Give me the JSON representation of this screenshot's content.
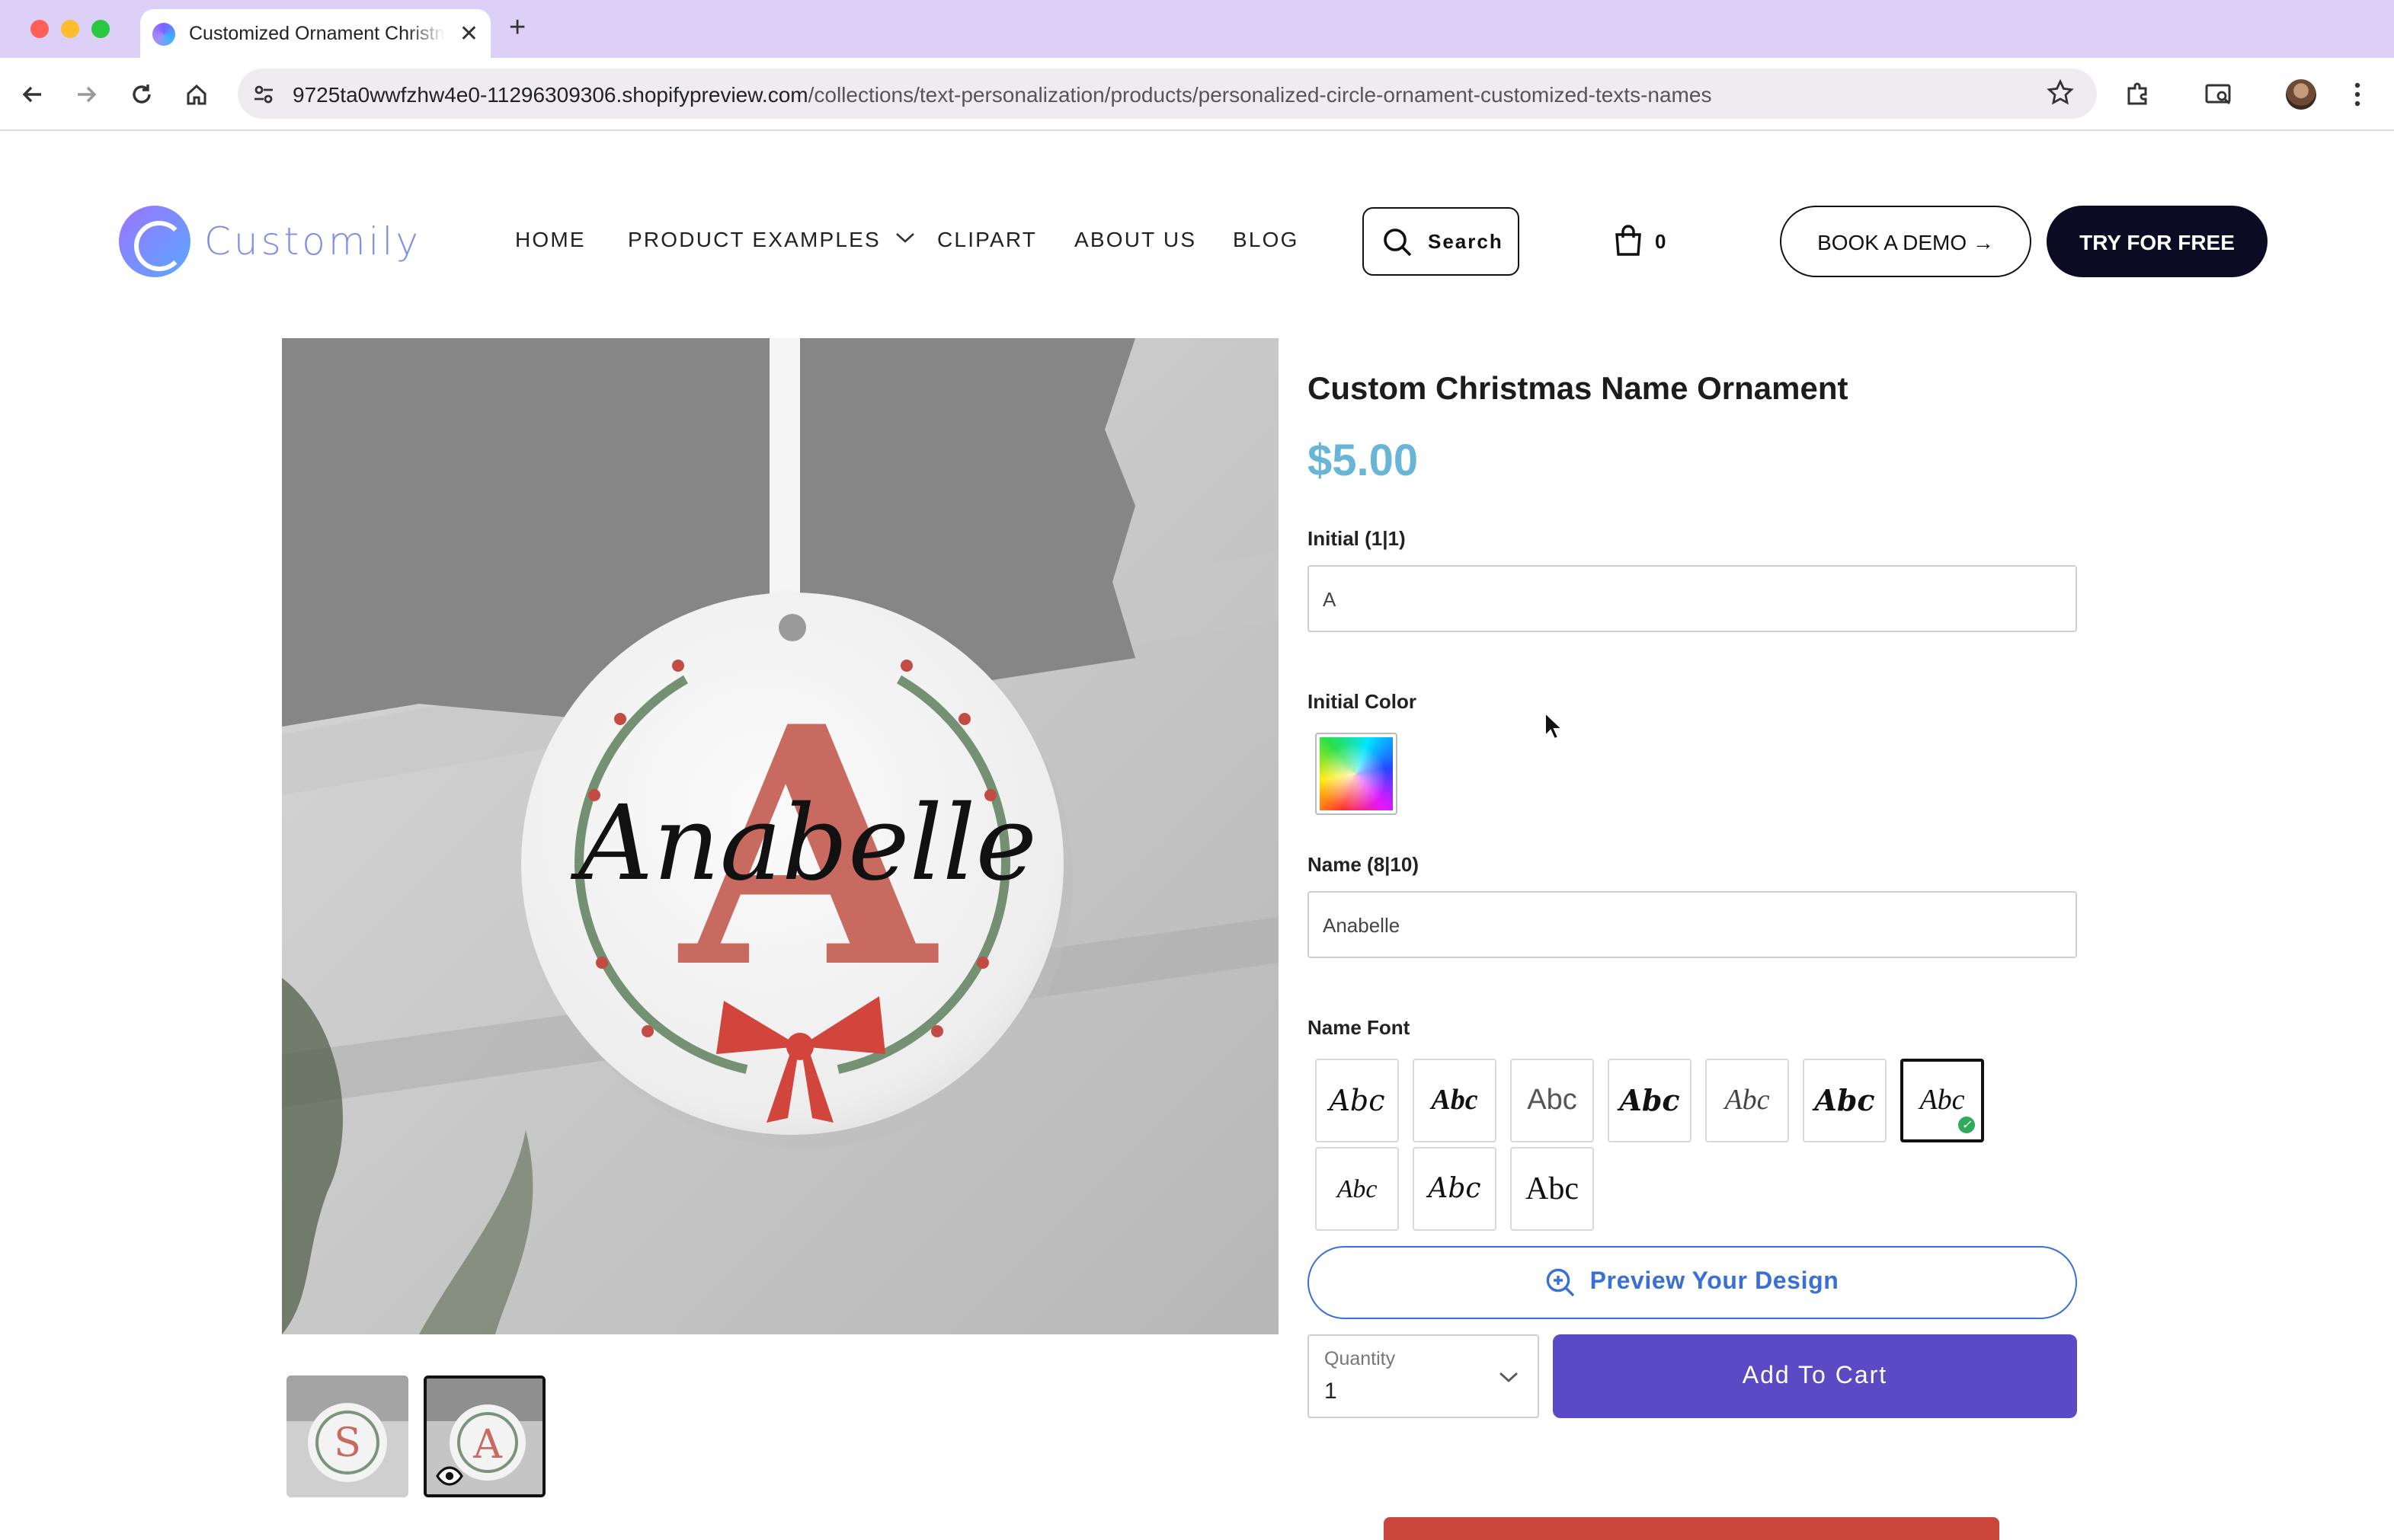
{
  "browser": {
    "tab_title": "Customized Ornament Christmas",
    "url_host": "9725ta0wwfzhw4e0-11296309306.shopifypreview.com",
    "url_path": "/collections/text-personalization/products/personalized-circle-ornament-customized-texts-names"
  },
  "header": {
    "logo_text": "Customily",
    "nav": [
      "HOME",
      "PRODUCT EXAMPLES",
      "CLIPART",
      "ABOUT US",
      "BLOG"
    ],
    "search_label": "Search",
    "cart_count": "0",
    "demo_label": "BOOK A DEMO →",
    "try_label": "TRY FOR FREE"
  },
  "gallery": {
    "main_initial": "A",
    "main_name": "Anabelle",
    "thumb1_initial": "S",
    "thumb2_initial": "A"
  },
  "product": {
    "title": "Custom Christmas Name Ornament",
    "price": "$5.00",
    "initial_label": "Initial (1|1)",
    "initial_value": "A",
    "color_label": "Initial Color",
    "name_label": "Name (8|10)",
    "name_value": "Anabelle",
    "font_label": "Name Font",
    "font_options": [
      "Abc",
      "Abc",
      "Abc",
      "Abc",
      "Abc",
      "Abc",
      "Abc",
      "Abc",
      "Abc",
      "Abc"
    ],
    "selected_font_index": 6,
    "preview_label": "Preview Your Design",
    "quantity_label": "Quantity",
    "quantity_value": "1",
    "add_to_cart_label": "Add To Cart"
  },
  "colors": {
    "tabbar": "#dcd0f7",
    "price": "#69b5d6",
    "preview_accent": "#3a6fd8",
    "add_to_cart": "#5a4ac3",
    "try_button": "#0d0a23",
    "initial_letter": "#c86a5f"
  },
  "icons": [
    "back-icon",
    "forward-icon",
    "reload-icon",
    "home-icon",
    "site-settings-icon",
    "bookmark-star-icon",
    "extensions-icon",
    "media-router-icon",
    "profile-avatar",
    "more-menu-icon",
    "search-icon",
    "cart-icon",
    "chevron-down-icon",
    "zoom-in-icon",
    "eye-icon",
    "check-icon"
  ]
}
